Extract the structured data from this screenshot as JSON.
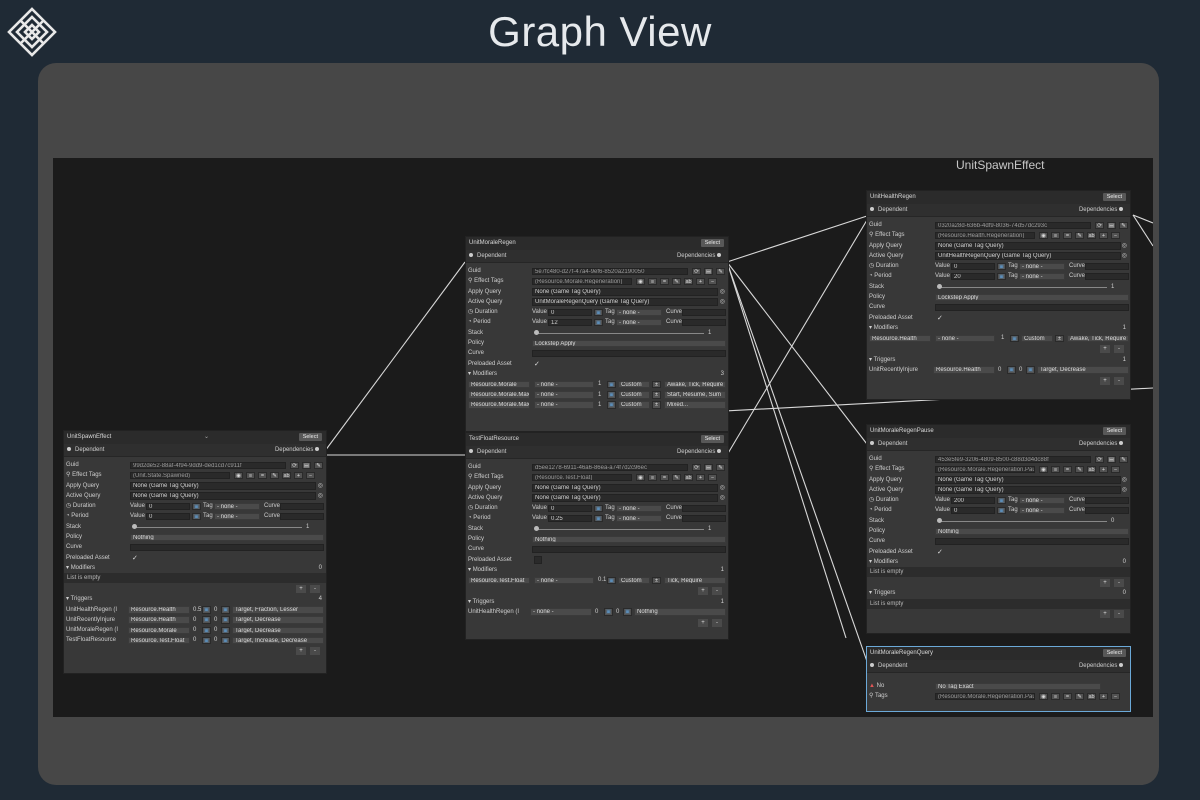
{
  "page": {
    "title": "Graph View",
    "canvas_label": "UnitSpawnEffect",
    "logo": "diamond-knot-logo"
  },
  "ui": {
    "dependent": "Dependent",
    "dependencies": "Dependencies",
    "select": "Select",
    "guid": "Guid",
    "effect_tags": "Effect Tags",
    "apply_query": "Apply Query",
    "active_query": "Active Query",
    "duration": "Duration",
    "period": "Period",
    "value": "Value",
    "tag": "Tag",
    "curve": "Curve",
    "stack": "Stack",
    "policy": "Policy",
    "preloaded_asset": "Preloaded Asset",
    "modifiers": "Modifiers",
    "triggers": "Triggers",
    "list_empty": "List is empty",
    "none_tag": "- none -",
    "none_query": "None (Game Tag Query)",
    "plus": "+",
    "minus": "-",
    "check": "✓",
    "no": "No",
    "tags": "Tags"
  },
  "nodes": {
    "spawn": {
      "title": "UnitSpawnEffect",
      "guid": "99d2de52-88af-4f94-9dd9-ded1cd7c911f",
      "effect_tags": "(Unit.State.Spawned)",
      "apply_query": "None (Game Tag Query)",
      "active_query": "None (Game Tag Query)",
      "duration": "0",
      "period": "0",
      "stack": "1",
      "policy": "Nothing",
      "modifiers_count": "0",
      "triggers_count": "4",
      "triggers": [
        {
          "name": "UnitHealthRegen (I",
          "tag": "Resource.Health",
          "n1": "0.5",
          "n2": "0",
          "action": "Target, Fraction, Lesser"
        },
        {
          "name": "UnitRecentlyInjure",
          "tag": "Resource.Health",
          "n1": "0",
          "n2": "0",
          "action": "Target, Decrease"
        },
        {
          "name": "UnitMoraleRegen (I",
          "tag": "Resource.Morale",
          "n1": "0",
          "n2": "0",
          "action": "Target, Decrease"
        },
        {
          "name": "TestFloatResource",
          "tag": "Resource.Test.Float",
          "n1": "0",
          "n2": "0",
          "action": "Target, Increase, Decrease"
        }
      ]
    },
    "morale": {
      "title": "UnitMoraleRegen",
      "guid": "5e7fc480-d27f-47a4-9ef6-8520a2190050",
      "effect_tags": "(Resource.Morale.Regeneration)",
      "apply_query": "None (Game Tag Query)",
      "active_query": "UnitMoraleRegenQuery (Game Tag Query)",
      "duration": "0",
      "period": "12",
      "stack": "1",
      "policy": "Lockstep Apply",
      "modifiers_count": "3",
      "modifiers": [
        {
          "tag": "Resource.Morale",
          "v": "1",
          "type": "Custom",
          "action": "Awake, Tick, Require"
        },
        {
          "tag": "Resource.Morale.Max",
          "v": "1",
          "type": "Custom",
          "action": "Start, Resume, Sum"
        },
        {
          "tag": "Resource.Morale.Max",
          "v": "1",
          "type": "Custom",
          "action": "Mixed..."
        }
      ]
    },
    "testfloat": {
      "title": "TestFloatResource",
      "guid": "d5ee1278-6911-46a6-86ea-a74f7d2c96ec",
      "effect_tags": "(Resource.Test.Float)",
      "apply_query": "None (Game Tag Query)",
      "active_query": "None (Game Tag Query)",
      "duration": "0",
      "period": "0.25",
      "stack": "1",
      "policy": "Nothing",
      "modifiers_count": "1",
      "triggers_count": "1",
      "modifier": {
        "tag": "Resource.Test.Float",
        "v": "0.1",
        "type": "Custom",
        "action": "Tick, Require"
      },
      "trigger": {
        "name": "UnitHealthRegen (I",
        "n1": "0",
        "n2": "0",
        "action": "Nothing"
      }
    },
    "health": {
      "title": "UnitHealthRegen",
      "guid": "0320a28d-636b-4df9-8036-74d57dc293c",
      "effect_tags": "(Resource.Health.Regeneration)",
      "apply_query": "None (Game Tag Query)",
      "active_query": "UnitHealthRegenQuery (Game Tag Query)",
      "duration": "0",
      "period": "20",
      "stack": "1",
      "policy": "Lockstep Apply",
      "modifiers_count": "1",
      "triggers_count": "1",
      "modifier": {
        "tag": "Resource.Health",
        "v": "1",
        "type": "Custom",
        "action": "Awake, Tick, Require"
      },
      "trigger": {
        "name": "UnitRecentlyInjure",
        "tag": "Resource.Health",
        "n1": "0",
        "n2": "0",
        "action": "Target, Decrease"
      }
    },
    "pause": {
      "title": "UnitMoraleRegenPause",
      "guid": "453e5fe9-3206-4809-8500-c88d3d4dc88f",
      "effect_tags": "(Resource.Morale.Regeneration.Pause)",
      "apply_query": "None (Game Tag Query)",
      "active_query": "None (Game Tag Query)",
      "duration": "200",
      "period": "0",
      "stack": "0",
      "policy": "Nothing",
      "modifiers_count": "0",
      "triggers_count": "0"
    },
    "query": {
      "title": "UnitMoraleRegenQuery",
      "mode": "No Tag Exact",
      "tags": "(Resource.Morale.Regeneration.Pause)"
    }
  }
}
